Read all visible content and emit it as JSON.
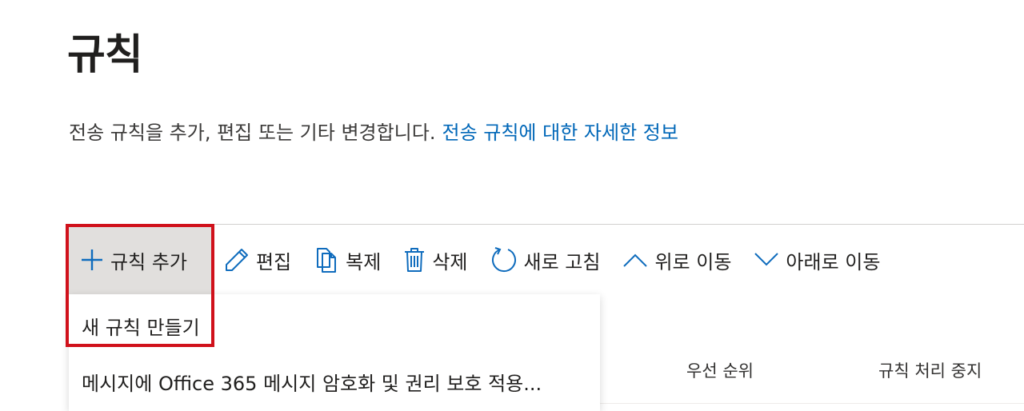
{
  "page": {
    "title": "규칙",
    "description": "전송 규칙을 추가, 편집 또는 기타 변경합니다.",
    "learn_more_link": "전송 규칙에 대한 자세한 정보"
  },
  "toolbar": {
    "add_label": "규칙 추가",
    "edit_label": "편집",
    "copy_label": "복제",
    "delete_label": "삭제",
    "refresh_label": "새로 고침",
    "move_up_label": "위로 이동",
    "move_down_label": "아래로 이동"
  },
  "dropdown": {
    "items": [
      {
        "label": "새 규칙 만들기"
      },
      {
        "label": "메시지에 Office 365 메시지 암호화 및 권리 보호 적용..."
      }
    ]
  },
  "table": {
    "columns": [
      "우선 순위",
      "규칙 처리 중지"
    ]
  },
  "colors": {
    "accent": "#0067b8",
    "highlight": "#d0111b",
    "selected_bg": "#e1dfdd"
  }
}
